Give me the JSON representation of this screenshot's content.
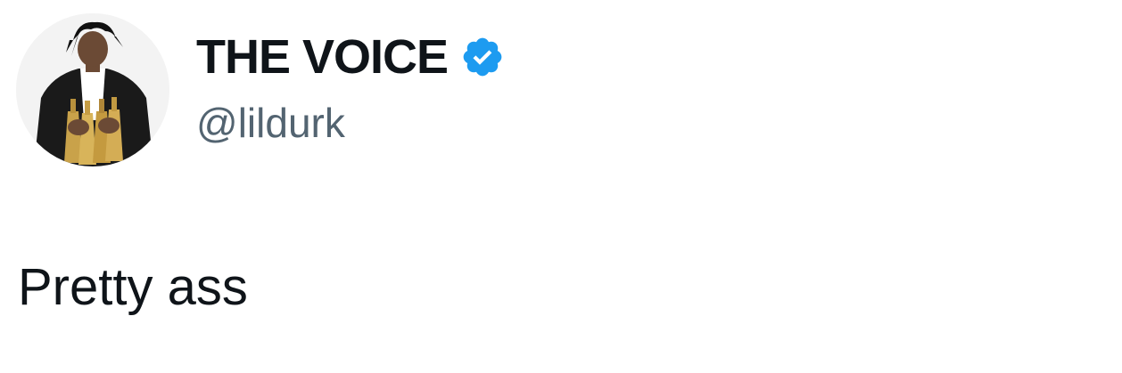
{
  "tweet": {
    "author": {
      "display_name": "THE VOICE",
      "handle": "@lildurk",
      "verified": true,
      "verified_badge_color": "#1d9bf0",
      "avatar_icon": "profile-photo"
    },
    "text": "Pretty ass"
  },
  "colors": {
    "text_primary": "#0f1419",
    "text_secondary": "#536471",
    "background": "#ffffff"
  }
}
